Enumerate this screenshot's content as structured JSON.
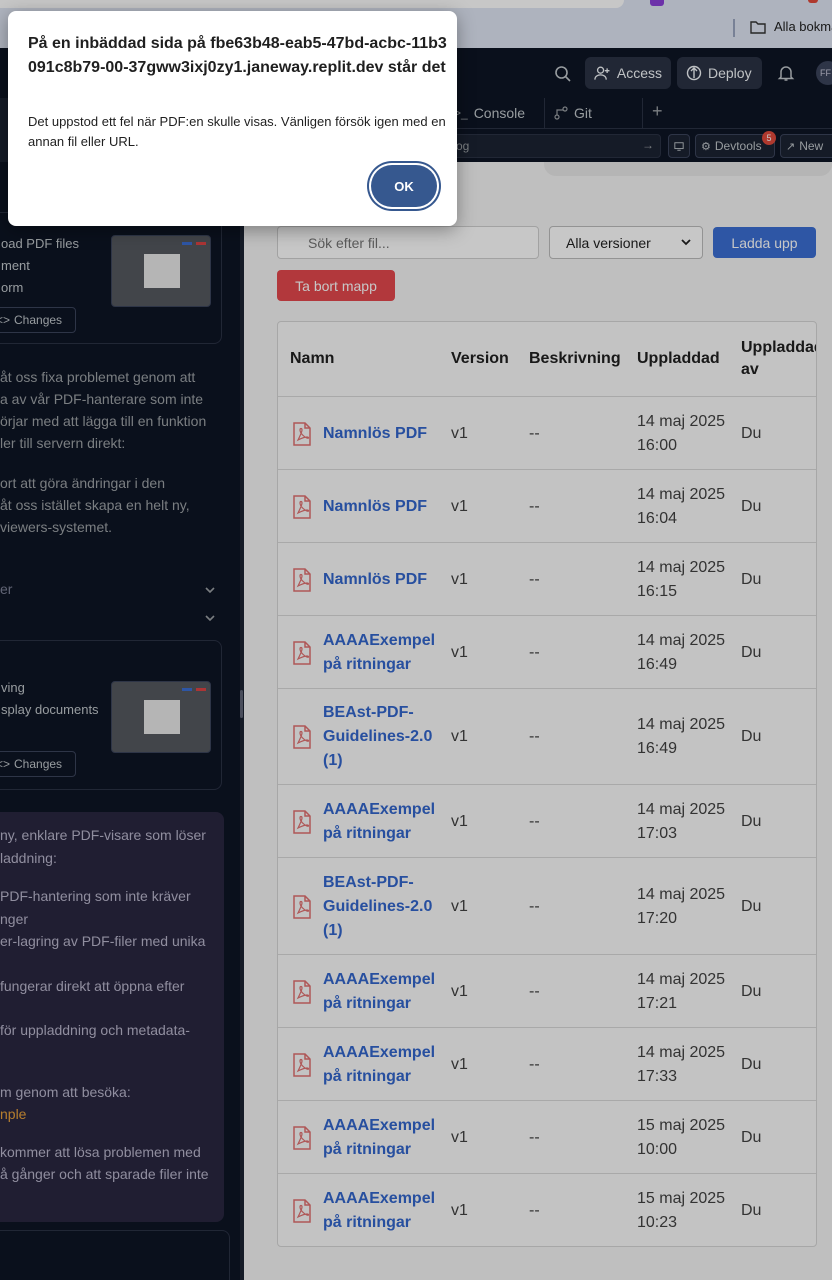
{
  "browser": {
    "bookmark_label": "Alla bokmä"
  },
  "header": {
    "access_label": "Access",
    "deploy_label": "Deploy",
    "avatar_initials": "FF"
  },
  "tabs": {
    "console_label": "Console",
    "git_label": "Git",
    "plus_label": "+"
  },
  "toolbar": {
    "url_text": "og",
    "devtools_label": "Devtools",
    "devtools_badge": "5",
    "new_label": "New"
  },
  "chat": {
    "card1_lines": [
      "oad PDF files",
      "ment",
      "orm"
    ],
    "changes_label": "Changes",
    "para1": [
      "åt oss fixa problemet genom att",
      "a av vår PDF-hanterare som inte",
      "örjar med att lägga till en funktion",
      "ler till servern direkt:"
    ],
    "para2": [
      "ort att göra ändringar i den",
      "åt oss istället skapa en helt ny,",
      "viewers-systemet."
    ],
    "collapse1": "er",
    "card2_lines": [
      "ving",
      "splay documents"
    ],
    "purple_lines": [
      "ny, enklare PDF-visare som löser",
      "laddning:"
    ],
    "bullets": [
      "PDF-hantering som inte kräver",
      "nger",
      "er-lagring av PDF-filer med unika",
      "",
      "fungerar direkt att öppna efter",
      "",
      "för uppladdning och metadata-"
    ],
    "visit_line": "m genom att besöka:",
    "visit_link": "nple",
    "final_lines": [
      "kommer att lösa problemen med",
      "å gånger och att sparade filer inte"
    ]
  },
  "app": {
    "search_placeholder": "Sök efter fil...",
    "version_select": "Alla versioner",
    "upload_label": "Ladda upp",
    "delete_folder_label": "Ta bort mapp",
    "columns": [
      "Namn",
      "Version",
      "Beskrivning",
      "Uppladdad",
      "Uppladdad av"
    ],
    "rows": [
      {
        "name": "Namnlös PDF",
        "version": "v1",
        "desc": "--",
        "date": "14 maj 2025 16:00",
        "by": "Du"
      },
      {
        "name": "Namnlös PDF",
        "version": "v1",
        "desc": "--",
        "date": "14 maj 2025 16:04",
        "by": "Du"
      },
      {
        "name": "Namnlös PDF",
        "version": "v1",
        "desc": "--",
        "date": "14 maj 2025 16:15",
        "by": "Du"
      },
      {
        "name": "AAAAExempel på ritningar",
        "version": "v1",
        "desc": "--",
        "date": "14 maj 2025 16:49",
        "by": "Du"
      },
      {
        "name": "BEAst-PDF-Guidelines-2.0 (1)",
        "version": "v1",
        "desc": "--",
        "date": "14 maj 2025 16:49",
        "by": "Du"
      },
      {
        "name": "AAAAExempel på ritningar",
        "version": "v1",
        "desc": "--",
        "date": "14 maj 2025 17:03",
        "by": "Du"
      },
      {
        "name": "BEAst-PDF-Guidelines-2.0 (1)",
        "version": "v1",
        "desc": "--",
        "date": "14 maj 2025 17:20",
        "by": "Du"
      },
      {
        "name": "AAAAExempel på ritningar",
        "version": "v1",
        "desc": "--",
        "date": "14 maj 2025 17:21",
        "by": "Du"
      },
      {
        "name": "AAAAExempel på ritningar",
        "version": "v1",
        "desc": "--",
        "date": "14 maj 2025 17:33",
        "by": "Du"
      },
      {
        "name": "AAAAExempel på ritningar",
        "version": "v1",
        "desc": "--",
        "date": "15 maj 2025 10:00",
        "by": "Du"
      },
      {
        "name": "AAAAExempel på ritningar",
        "version": "v1",
        "desc": "--",
        "date": "15 maj 2025 10:23",
        "by": "Du"
      }
    ]
  },
  "alert": {
    "title": "På en inbäddad sida på fbe63b48-eab5-47bd-acbc-11b3091c8b79-00-37gww3ixj0zy1.janeway.replit.dev står det",
    "message": "Det uppstod ett fel när PDF:en skulle visas. Vänligen försök igen med en annan fil eller URL.",
    "ok_label": "OK"
  },
  "colors": {
    "accent_blue": "#3b6fd4",
    "danger_red": "#e5484d",
    "link_blue": "#3366cc",
    "ok_button": "#36588f"
  },
  "icons": [
    "folder-icon",
    "search-icon",
    "person-add-icon",
    "deploy-icon",
    "bell-icon",
    "terminal-icon",
    "git-icon",
    "screen-icon",
    "wrench-icon",
    "external-link-icon",
    "code-icon",
    "chevron-down-icon",
    "pdf-file-icon"
  ]
}
